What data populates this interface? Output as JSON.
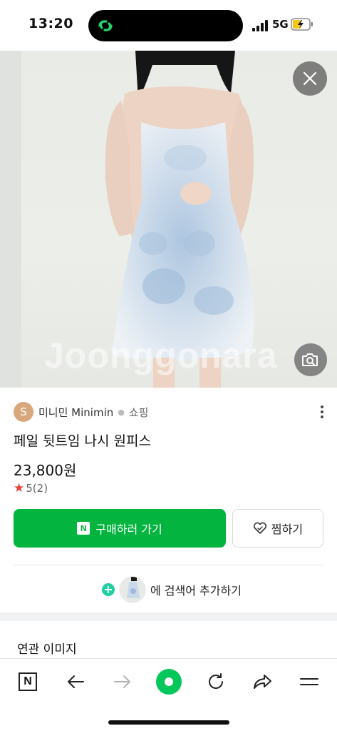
{
  "status_bar": {
    "time": "13:20",
    "network": "5G"
  },
  "image": {
    "watermark": "Joonggonara"
  },
  "product": {
    "seller_initial": "S",
    "seller_name": "미니민 Minimin",
    "category": "쇼핑",
    "title": "페일 뒷트임 나시 원피스",
    "price": "23,800원",
    "rating": "5",
    "review_count": "(2)"
  },
  "actions": {
    "buy_logo": "N",
    "buy_label": "구매하러 가기",
    "wish_label": "찜하기",
    "add_search_label": "에 검색어 추가하기"
  },
  "related": {
    "title": "연관 이미지"
  },
  "toolbar": {
    "n_label": "N"
  },
  "colors": {
    "buy_green": "#03b43f",
    "naver_green": "#03c75a",
    "star_red": "#e94235",
    "add_mint": "#1fcf9f"
  }
}
